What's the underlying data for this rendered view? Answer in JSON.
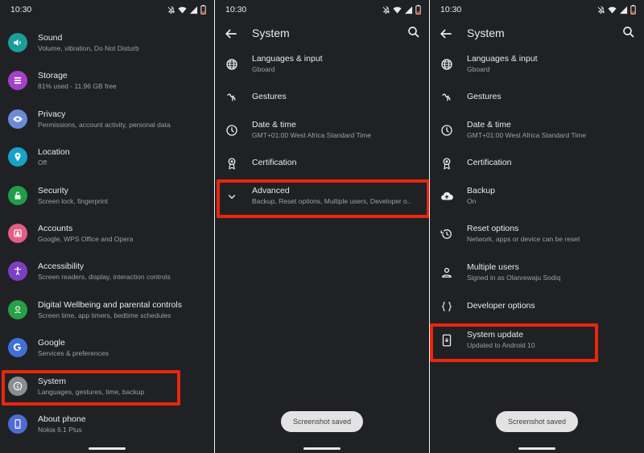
{
  "status": {
    "time": "10:30"
  },
  "colors": {
    "highlight": "#e8270d",
    "background": "#202124"
  },
  "panel1": {
    "items": [
      {
        "title": "Sound",
        "subtitle": "Volume, vibration, Do Not Disturb",
        "icon": "volume-icon",
        "color": "#1a9e9b"
      },
      {
        "title": "Storage",
        "subtitle": "81% used - 11.96 GB free",
        "icon": "storage-icon",
        "color": "#a540c9"
      },
      {
        "title": "Privacy",
        "subtitle": "Permissions, account activity, personal data",
        "icon": "eye-icon",
        "color": "#6b8bd9"
      },
      {
        "title": "Location",
        "subtitle": "Off",
        "icon": "location-pin-icon",
        "color": "#17a2c7"
      },
      {
        "title": "Security",
        "subtitle": "Screen lock, fingerprint",
        "icon": "lock-icon",
        "color": "#1e9e48"
      },
      {
        "title": "Accounts",
        "subtitle": "Google, WPS Office and Opera",
        "icon": "account-icon",
        "color": "#e35d86"
      },
      {
        "title": "Accessibility",
        "subtitle": "Screen readers, display, interaction controls",
        "icon": "accessibility-icon",
        "color": "#7d3fc2"
      },
      {
        "title": "Digital Wellbeing and parental controls",
        "subtitle": "Screen time, app timers, bedtime schedules",
        "icon": "wellbeing-icon",
        "color": "#27a047"
      },
      {
        "title": "Google",
        "subtitle": "Services & preferences",
        "icon": "google-icon",
        "color": "#4070d8"
      },
      {
        "title": "System",
        "subtitle": "Languages, gestures, time, backup",
        "icon": "info-icon",
        "color": "#8a8d91"
      },
      {
        "title": "About phone",
        "subtitle": "Nokia 6.1 Plus",
        "icon": "phone-icon",
        "color": "#4d6bd3"
      }
    ]
  },
  "panel2": {
    "title": "System",
    "items": [
      {
        "title": "Languages & input",
        "subtitle": "Gboard",
        "icon": "globe-icon"
      },
      {
        "title": "Gestures",
        "subtitle": "",
        "icon": "gestures-icon"
      },
      {
        "title": "Date & time",
        "subtitle": "GMT+01:00 West Africa Standard Time",
        "icon": "clock-icon"
      },
      {
        "title": "Certification",
        "subtitle": "",
        "icon": "certificate-icon"
      },
      {
        "title": "Advanced",
        "subtitle": "Backup, Reset options, Multiple users, Developer o..",
        "icon": "chevron-down-icon"
      }
    ],
    "toast": "Screenshot saved"
  },
  "panel3": {
    "title": "System",
    "items": [
      {
        "title": "Languages & input",
        "subtitle": "Gboard",
        "icon": "globe-icon"
      },
      {
        "title": "Gestures",
        "subtitle": "",
        "icon": "gestures-icon"
      },
      {
        "title": "Date & time",
        "subtitle": "GMT+01:00 West Africa Standard Time",
        "icon": "clock-icon"
      },
      {
        "title": "Certification",
        "subtitle": "",
        "icon": "certificate-icon"
      },
      {
        "title": "Backup",
        "subtitle": "On",
        "icon": "cloud-upload-icon"
      },
      {
        "title": "Reset options",
        "subtitle": "Network, apps or device can be reset",
        "icon": "history-icon"
      },
      {
        "title": "Multiple users",
        "subtitle": "Signed in as Olanrewaju Sodiq",
        "icon": "person-icon"
      },
      {
        "title": "Developer options",
        "subtitle": "",
        "icon": "code-braces-icon"
      },
      {
        "title": "System update",
        "subtitle": "Updated to Android 10",
        "icon": "system-update-icon"
      }
    ],
    "toast": "Screenshot saved"
  }
}
